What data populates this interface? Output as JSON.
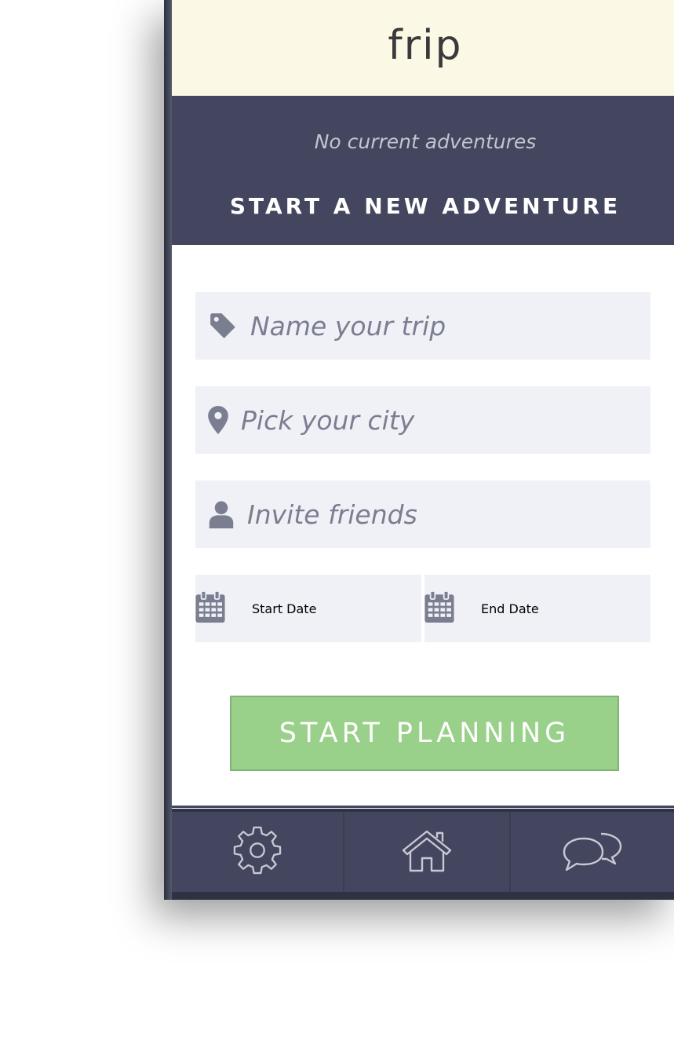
{
  "app": {
    "title": "frip"
  },
  "banner": {
    "status": "No current adventures",
    "cta": "START A NEW ADVENTURE"
  },
  "form": {
    "trip_name": {
      "placeholder": "Name your trip",
      "icon": "tag-icon"
    },
    "city": {
      "placeholder": "Pick your city",
      "icon": "map-pin-icon"
    },
    "friends": {
      "placeholder": "Invite friends",
      "icon": "user-icon"
    },
    "start_date": {
      "placeholder": "Start Date",
      "icon": "calendar-icon"
    },
    "end_date": {
      "placeholder": "End Date",
      "icon": "calendar-icon"
    },
    "submit_label": "START PLANNING"
  },
  "tabbar": {
    "items": [
      {
        "icon": "gear-icon"
      },
      {
        "icon": "home-icon"
      },
      {
        "icon": "chat-icon"
      }
    ]
  },
  "colors": {
    "header_bg": "#fbf9e6",
    "navy": "#43465e",
    "field_bg": "#f0f1f7",
    "placeholder": "#7b7e91",
    "accent_green": "#99d08a"
  }
}
